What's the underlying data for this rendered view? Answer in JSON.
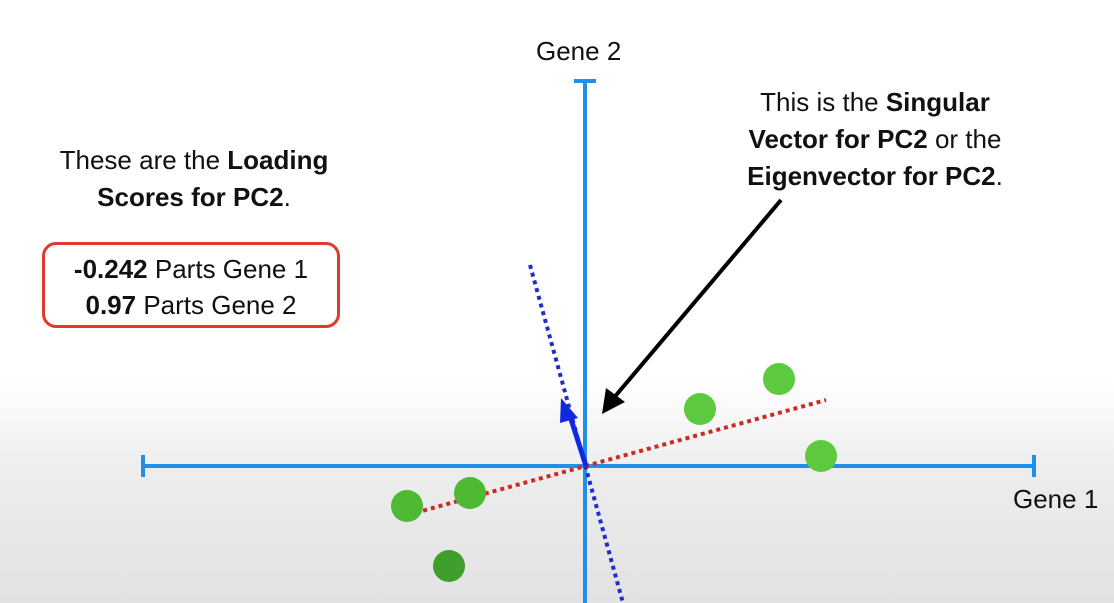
{
  "axes": {
    "x_label": "Gene 1",
    "y_label": "Gene 2",
    "colors": {
      "axis": "#1f8fe8",
      "pc1_line": "#cc2a24",
      "pc2_line": "#1f2ec8",
      "arrow": "#1029e0",
      "points": "#4cbb35"
    }
  },
  "left_note": {
    "line1_plain": "These are the ",
    "line1_bold": "Loading",
    "line2_bold": "Scores for PC2",
    "line2_tail": "."
  },
  "loading_box": {
    "row1_value": "-0.242",
    "row1_text": " Parts Gene 1",
    "row2_value": "0.97",
    "row2_text": " Parts Gene 2"
  },
  "right_note": {
    "line1_plain": "This is the ",
    "line1_bold": "Singular",
    "line2_bold": "Vector for PC2",
    "line2_plain": " or the",
    "line3_bold": "Eigenvector for PC2",
    "line3_tail": "."
  },
  "points_count": 6
}
